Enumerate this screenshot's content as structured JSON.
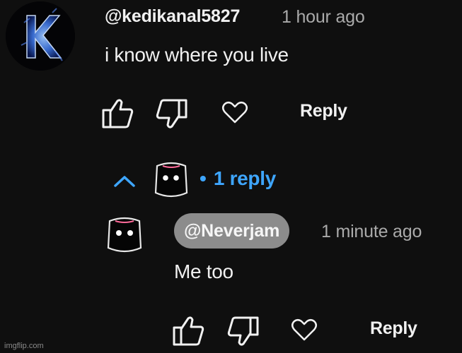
{
  "comment": {
    "handle": "@kedikanal5827",
    "time": "1 hour ago",
    "text": "i know where you live",
    "reply_label": "Reply",
    "avatar_icon": "k-letter-avatar"
  },
  "replies_toggle": {
    "icon": "chevron-up-icon",
    "separator": "•",
    "count_label": "1 reply"
  },
  "reply": {
    "mention": "@Neverjam",
    "time": "1 minute ago",
    "text": "Me too",
    "reply_label": "Reply",
    "avatar_icon": "black-cat-avatar"
  },
  "watermark": "imgflip.com",
  "colors": {
    "background": "#0f0f0f",
    "text": "#f1f1f1",
    "muted": "#aaaaaa",
    "link_blue": "#3ea6ff",
    "mention_chip": "#8c8c8c"
  }
}
